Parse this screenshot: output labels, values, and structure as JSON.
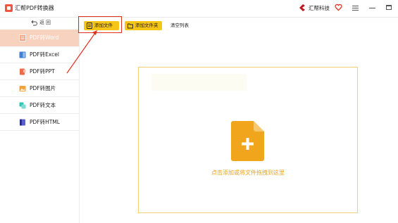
{
  "window": {
    "title": "汇帮PDF转换器",
    "brand": "汇帮科技"
  },
  "sidebar": {
    "back_label": "返回",
    "items": [
      {
        "label": "PDF转Word",
        "icon": "word-icon",
        "active": true
      },
      {
        "label": "PDF转Excel",
        "icon": "excel-icon",
        "active": false
      },
      {
        "label": "PDF转PPT",
        "icon": "ppt-icon",
        "active": false
      },
      {
        "label": "PDF转图片",
        "icon": "image-icon",
        "active": false
      },
      {
        "label": "PDF转文本",
        "icon": "text-icon",
        "active": false
      },
      {
        "label": "PDF转HTML",
        "icon": "html-icon",
        "active": false
      }
    ]
  },
  "toolbar": {
    "add_file_label": "添加文件",
    "add_folder_label": "添加文件夹",
    "clear_label": "清空列表"
  },
  "dropzone": {
    "hint": "点击添加或将文件拖拽到这里"
  },
  "colors": {
    "accent_yellow": "#f5c518",
    "active_item": "#f7d2be",
    "highlight_red": "#e0301e",
    "dropzone_border": "#f2cf74",
    "hint_text": "#e9a21a",
    "file_icon": "#f0a51c"
  }
}
